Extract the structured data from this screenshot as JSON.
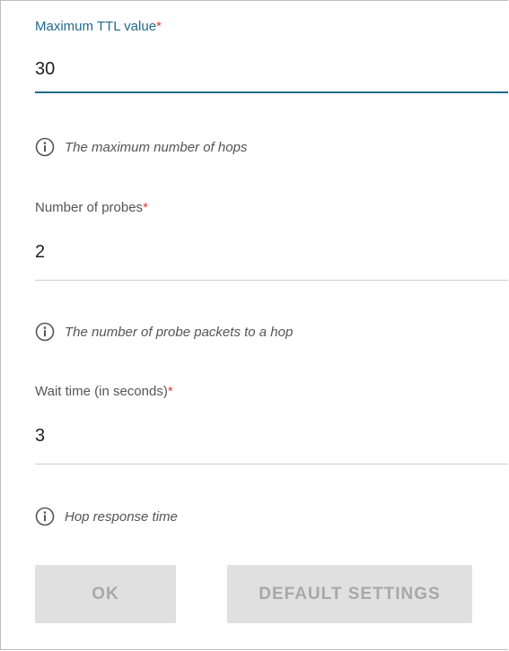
{
  "form": {
    "fields": [
      {
        "label": "Maximum TTL value",
        "required_mark": "*",
        "value": "30",
        "hint": "The maximum number of hops",
        "hint_icon": "info-icon"
      },
      {
        "label": "Number of probes",
        "required_mark": "*",
        "value": "2",
        "hint": "The number of probe packets to a hop",
        "hint_icon": "info-icon"
      },
      {
        "label": "Wait time (in seconds)",
        "required_mark": "*",
        "value": "3",
        "hint": "Hop response time",
        "hint_icon": "info-icon"
      }
    ],
    "buttons": {
      "ok_label": "OK",
      "default_label": "DEFAULT SETTINGS"
    }
  },
  "colors": {
    "active_accent": "#1d6a8a",
    "required_mark": "#e53935",
    "disabled_button_bg": "#e0e0e0",
    "disabled_button_text": "#a8a8a8"
  }
}
